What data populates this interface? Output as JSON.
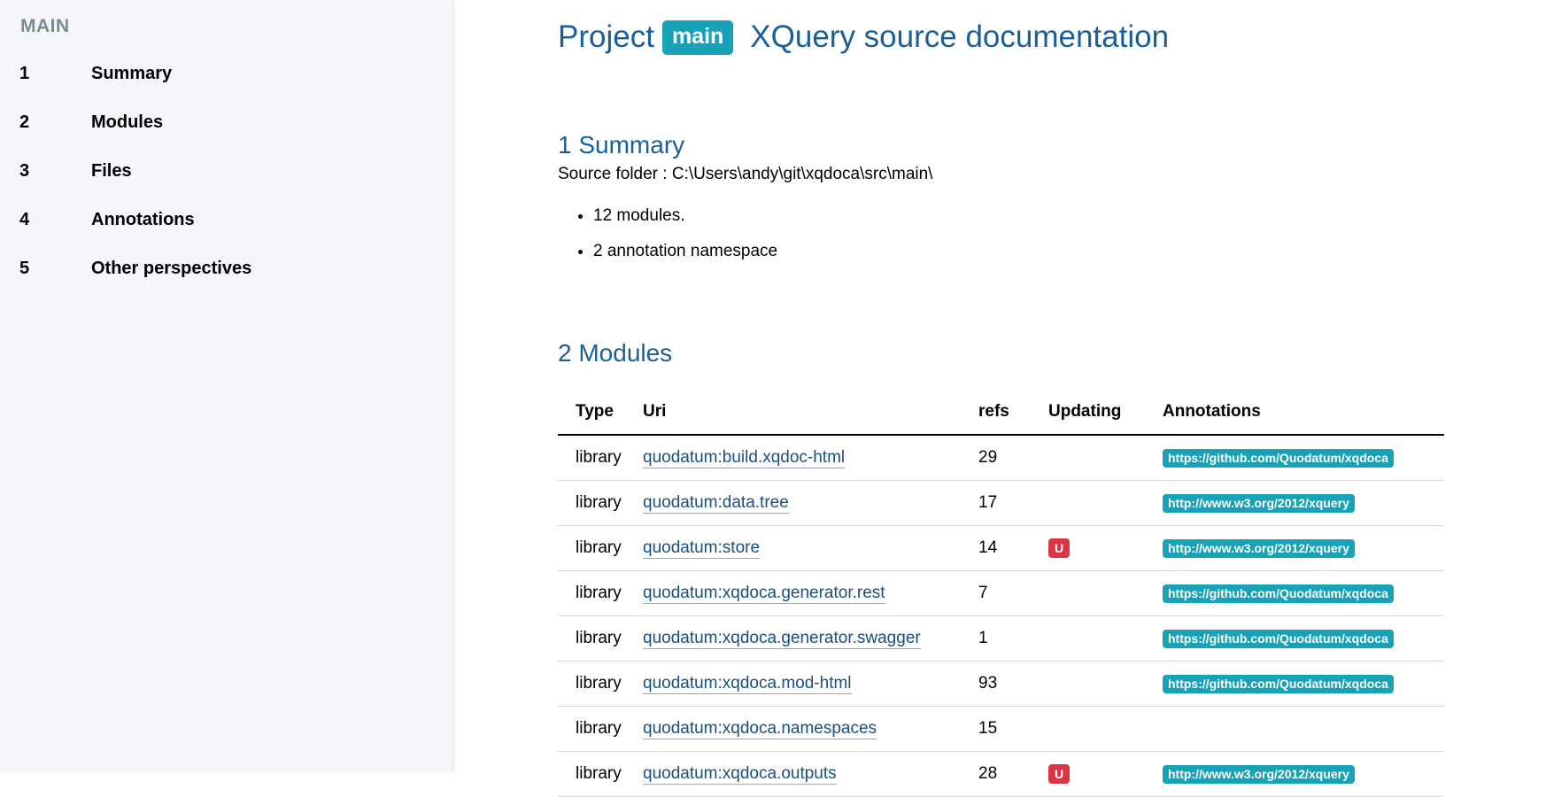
{
  "sidebar": {
    "heading": "MAIN",
    "items": [
      {
        "num": "1",
        "label": "Summary"
      },
      {
        "num": "2",
        "label": "Modules"
      },
      {
        "num": "3",
        "label": "Files"
      },
      {
        "num": "4",
        "label": "Annotations"
      },
      {
        "num": "5",
        "label": "Other perspectives"
      }
    ]
  },
  "header": {
    "prefix": "Project",
    "badge": "main",
    "suffix": "XQuery source documentation"
  },
  "summary": {
    "heading": "1 Summary",
    "source": "Source folder : C:\\Users\\andy\\git\\xqdoca\\src\\main\\",
    "bullets": [
      "12 modules.",
      "2 annotation namespace"
    ]
  },
  "modules": {
    "heading": "2 Modules",
    "columns": [
      "Type",
      "Uri",
      "refs",
      "Updating",
      "Annotations"
    ],
    "rows": [
      {
        "type": "library",
        "uri": "quodatum:build.xqdoc-html",
        "refs": "29",
        "updating": "",
        "annotation": "https://github.com/Quodatum/xqdoca"
      },
      {
        "type": "library",
        "uri": "quodatum:data.tree",
        "refs": "17",
        "updating": "",
        "annotation": "http://www.w3.org/2012/xquery"
      },
      {
        "type": "library",
        "uri": "quodatum:store",
        "refs": "14",
        "updating": "U",
        "annotation": "http://www.w3.org/2012/xquery"
      },
      {
        "type": "library",
        "uri": "quodatum:xqdoca.generator.rest",
        "refs": "7",
        "updating": "",
        "annotation": "https://github.com/Quodatum/xqdoca"
      },
      {
        "type": "library",
        "uri": "quodatum:xqdoca.generator.swagger",
        "refs": "1",
        "updating": "",
        "annotation": "https://github.com/Quodatum/xqdoca"
      },
      {
        "type": "library",
        "uri": "quodatum:xqdoca.mod-html",
        "refs": "93",
        "updating": "",
        "annotation": "https://github.com/Quodatum/xqdoca"
      },
      {
        "type": "library",
        "uri": "quodatum:xqdoca.namespaces",
        "refs": "15",
        "updating": "",
        "annotation": ""
      },
      {
        "type": "library",
        "uri": "quodatum:xqdoca.outputs",
        "refs": "28",
        "updating": "U",
        "annotation": "http://www.w3.org/2012/xquery"
      }
    ]
  },
  "colors": {
    "accent": "#17a2b8",
    "heading": "#1b5f98",
    "updating": "#dc3545"
  }
}
